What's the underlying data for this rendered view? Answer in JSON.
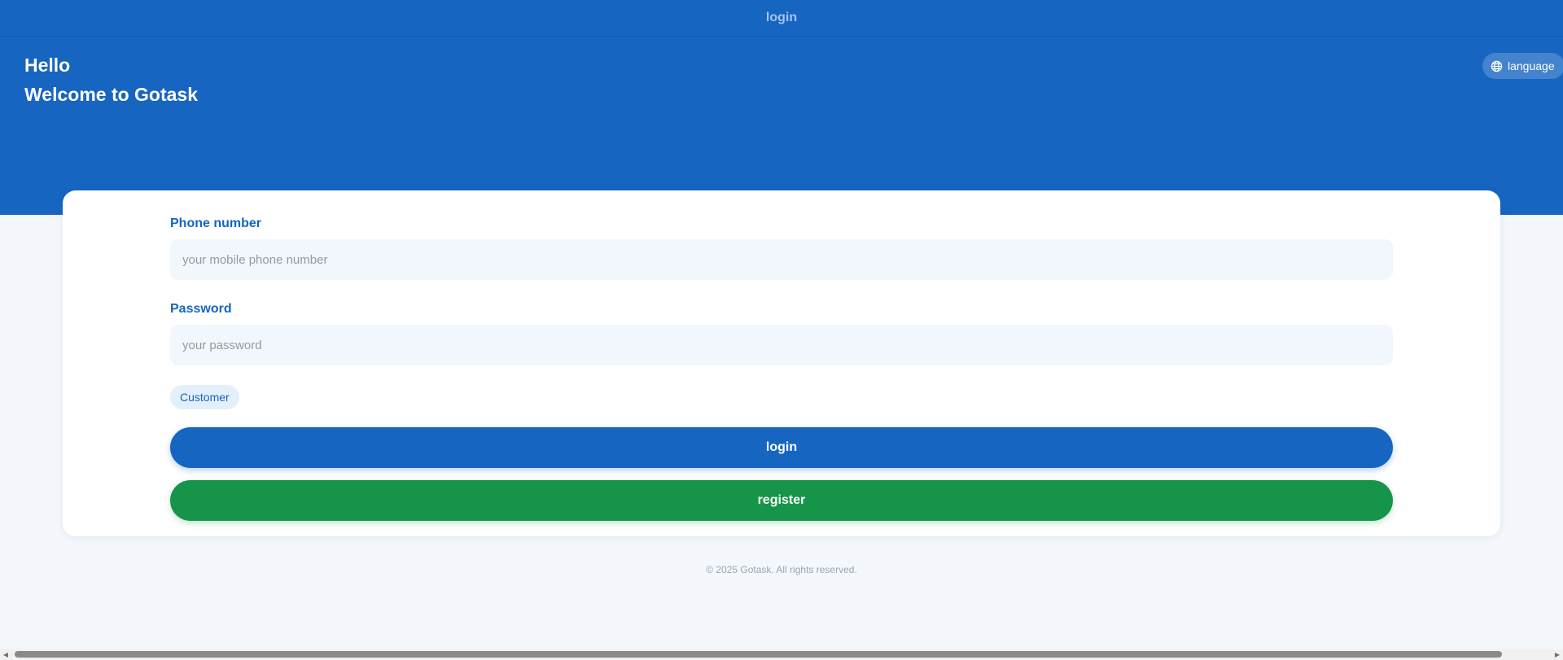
{
  "header": {
    "title": "login"
  },
  "hero": {
    "greeting": "Hello",
    "welcome": "Welcome to Gotask",
    "language_button": {
      "label": "language",
      "icon": "globe-icon"
    }
  },
  "form": {
    "phone": {
      "label": "Phone number",
      "placeholder": "your mobile phone number",
      "value": ""
    },
    "password": {
      "label": "Password",
      "placeholder": "your password",
      "value": ""
    },
    "role_chip": "Customer",
    "login_button": "login",
    "register_button": "register"
  },
  "footer": {
    "copyright": "© 2025 Gotask. All rights reserved."
  },
  "colors": {
    "primary": "#1665c1",
    "success": "#16944a",
    "background": "#f4f7fc",
    "input_bg": "#f2f6fd"
  }
}
